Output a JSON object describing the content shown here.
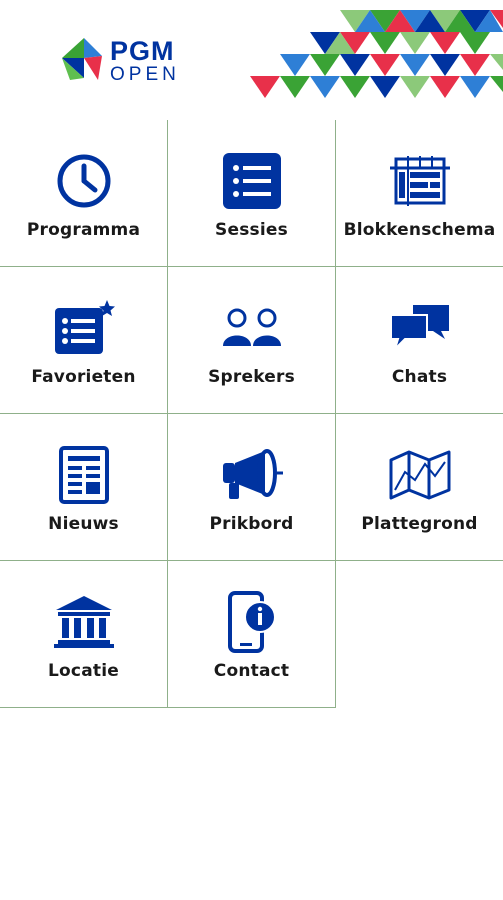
{
  "app": {
    "logo_top": "PGM",
    "logo_bottom": "OPEN",
    "brand_color": "#0033a0",
    "grid_line_color": "#8fb08a"
  },
  "menu": [
    {
      "label": "Programma",
      "icon": "clock-icon"
    },
    {
      "label": "Sessies",
      "icon": "list-icon"
    },
    {
      "label": "Blokkenschema",
      "icon": "schedule-grid-icon"
    },
    {
      "label": "Favorieten",
      "icon": "favorite-list-icon"
    },
    {
      "label": "Sprekers",
      "icon": "speakers-icon"
    },
    {
      "label": "Chats",
      "icon": "chat-bubbles-icon"
    },
    {
      "label": "Nieuws",
      "icon": "newspaper-icon"
    },
    {
      "label": "Prikbord",
      "icon": "megaphone-icon"
    },
    {
      "label": "Plattegrond",
      "icon": "map-icon"
    },
    {
      "label": "Locatie",
      "icon": "building-icon"
    },
    {
      "label": "Contact",
      "icon": "phone-info-icon"
    }
  ]
}
